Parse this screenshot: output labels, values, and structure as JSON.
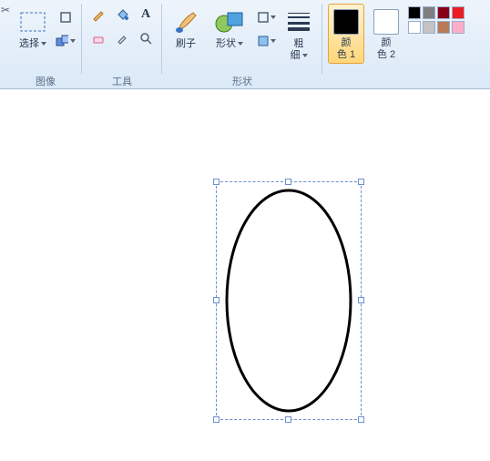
{
  "ribbon": {
    "cut_icon": "cut",
    "image_group": {
      "select_label": "选择",
      "group_label": "图像"
    },
    "tools_group": {
      "group_label": "工具"
    },
    "shapes_group": {
      "brush_label": "刷子",
      "shape_label": "形状",
      "size_label": "粗\n细",
      "group_label": "形状"
    },
    "colors": {
      "color1_label": "颜\n色 1",
      "color2_label": "颜\n色 2",
      "color1_value": "#000000",
      "color2_value": "#ffffff",
      "palette": [
        "#000000",
        "#7f7f7f",
        "#880015",
        "#ed1c24",
        "#ffffff",
        "#c3c3c3",
        "#b97a57",
        "#ffaec9"
      ]
    }
  },
  "canvas": {
    "shape": {
      "type": "ellipse",
      "stroke": "#000000",
      "stroke_width": 3,
      "selected": true
    }
  }
}
